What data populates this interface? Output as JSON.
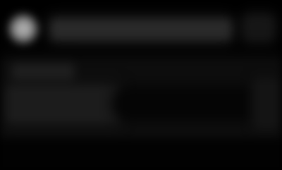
{
  "colors": {
    "background": "#000000",
    "avatar": "#c4c4c4",
    "bar": "#2a2a2a",
    "card": "#0d0d0d",
    "field": "#050505"
  },
  "header": {
    "avatar_icon": "avatar-icon",
    "title": "",
    "menu_icon": "more-icon"
  },
  "card": {
    "label": "",
    "field_value": ""
  }
}
